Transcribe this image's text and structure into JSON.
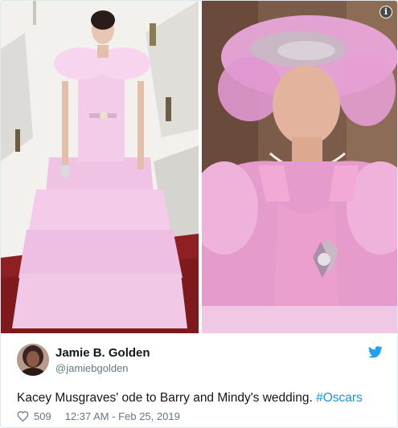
{
  "tweet": {
    "author_name": "Jamie B. Golden",
    "author_handle": "@jamiebgolden",
    "text_main": "Kacey Musgraves' ode to Barry and Mindy's wedding. ",
    "hashtag": "#Oscars",
    "like_count": "509",
    "timestamp": "12:37 AM - Feb 25, 2019"
  },
  "icons": {
    "info": "i",
    "brand": "twitter-bird-icon",
    "like": "heart-icon"
  },
  "colors": {
    "link": "#1b95e0",
    "secondary_text": "#657786",
    "primary_text": "#14171a",
    "brand": "#1da1f2"
  }
}
